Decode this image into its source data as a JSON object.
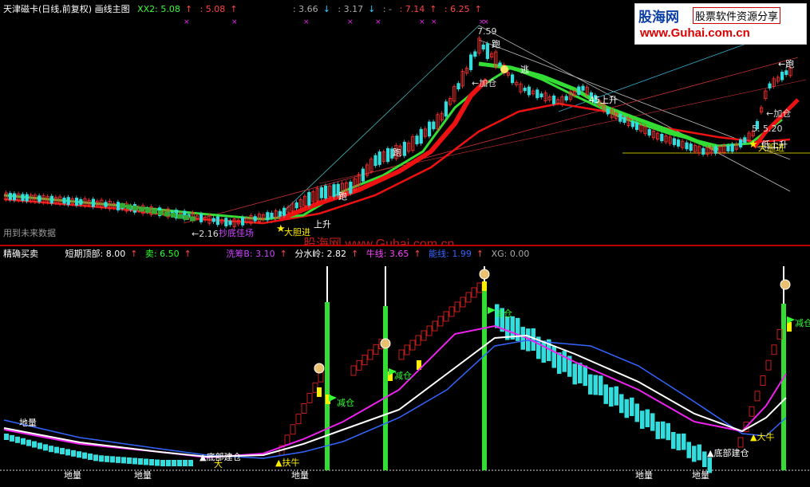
{
  "top_header": {
    "title": "天津磁卡(日线,前复权) 画线主图",
    "xx2": "XX2: 5.08",
    "xx2b": ": 5.08",
    "v1": ": 3.66",
    "v2": ": 3.17",
    "v3": ": -",
    "v4": ": 7.14",
    "v5": ": 6.25"
  },
  "logo": {
    "brand": "股海网",
    "slogan": "股票软件资源分享",
    "url": "www.Guhai.com.cn"
  },
  "top_labels": {
    "high_price": "7.59",
    "run1": "跑",
    "escape": "逃",
    "add1": "←加仓",
    "rise45": "45上升",
    "run2": "跑",
    "run3": "←跑",
    "add2": "←加仓",
    "price_range": "5.   5.20",
    "bold_buy2": "大胆进",
    "kline_up": "低上升",
    "run4": "跑",
    "rise2": "上升",
    "low_price": "←2.16",
    "abandon": "抄底佳场",
    "bold_buy": "大胆进",
    "future_data": "用到未来数据",
    "watermark": "股海网 www.Guhai.com.cn"
  },
  "bottom_header": {
    "title": "精确买卖",
    "short_top": "短期顶部: 8.00",
    "sell": "卖: 6.50",
    "wash": "洗筹B: 3.10",
    "divide": "分水岭: 2.82",
    "bull": "牛线: 3.65",
    "energy": "能线: 1.99",
    "xg": "XG: 0.00"
  },
  "bottom_labels": {
    "dimian": "地量",
    "jiancang1": "减仓",
    "jiancang2": "减仓",
    "jiancang3": "减仓",
    "jiancang4": "减仓",
    "dibu1": "▲底部建仓",
    "dibu2": "▲底部建仓",
    "daniu": "▲大牛",
    "fuhu": "▲扶牛",
    "dadi1": "地量",
    "dadi2": "地量",
    "dadi3": "地量",
    "dadi4": "地量",
    "dadi5": "地量",
    "dayi": "大"
  },
  "colors": {
    "up": "#ff3030",
    "down": "#33dddd",
    "ma_green": "#33dd33",
    "ma_red": "#ee1111",
    "white": "#ffffff",
    "magenta": "#ee22ee",
    "blue": "#3366ff",
    "yellow": "#ffee00"
  }
}
